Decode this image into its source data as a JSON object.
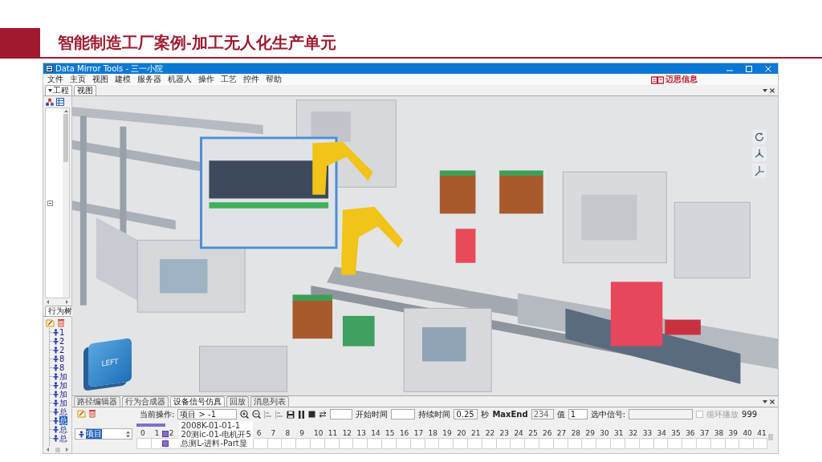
{
  "slide": {
    "title": "智能制造工厂案例-加工无人化生产单元"
  },
  "window": {
    "title": "Data Mirror Tools - 三一小院",
    "menu": [
      "文件",
      "主页",
      "视图",
      "建模",
      "服务器",
      "机器人",
      "操作",
      "工艺",
      "控件",
      "帮助"
    ],
    "logo": "迈思信息"
  },
  "project_panel": {
    "tab": "工程"
  },
  "behavior_panel": {
    "tab": "行为树",
    "items": [
      {
        "label": "1",
        "selected": false
      },
      {
        "label": "2",
        "selected": false
      },
      {
        "label": "2",
        "selected": false
      },
      {
        "label": "8",
        "selected": false
      },
      {
        "label": "8",
        "selected": false
      },
      {
        "label": "加",
        "selected": false
      },
      {
        "label": "加",
        "selected": false
      },
      {
        "label": "加",
        "selected": false
      },
      {
        "label": "加",
        "selected": false
      },
      {
        "label": "总",
        "selected": false
      },
      {
        "label": "总",
        "selected": true
      },
      {
        "label": "总",
        "selected": false
      },
      {
        "label": "总",
        "selected": false
      }
    ]
  },
  "viewport": {
    "tab": "视图",
    "view_cube": "LEFT"
  },
  "signal_panel": {
    "tabs": [
      {
        "label": "路径编辑器",
        "selected": false
      },
      {
        "label": "行为合成器",
        "selected": false
      },
      {
        "label": "设备信号仿真",
        "selected": true
      },
      {
        "label": "回放",
        "selected": false
      },
      {
        "label": "消息列表",
        "selected": false
      }
    ],
    "tree_item": {
      "label": "项目",
      "selected": true
    },
    "toolbar": {
      "operation": {
        "label": "当前操作:",
        "value": "项目 > -1"
      },
      "buttons": [
        {
          "kind": "zoom-in",
          "disabled": false
        },
        {
          "kind": "zoom-out",
          "disabled": false
        },
        {
          "kind": "align",
          "disabled": true
        },
        {
          "kind": "align",
          "disabled": true
        },
        {
          "kind": "save",
          "disabled": false
        },
        {
          "kind": "pause",
          "disabled": false
        },
        {
          "kind": "stop",
          "disabled": false
        },
        {
          "kind": "swap",
          "disabled": false
        }
      ],
      "start_time": {
        "label": "开始时间"
      },
      "duration": {
        "label": "持续时间",
        "value": "0.25",
        "unit": "秒"
      },
      "max_end": {
        "label": "MaxEnd",
        "value": "234",
        "disabled": true
      },
      "value": {
        "label": "值",
        "value": "1"
      },
      "selected_signal": {
        "label": "选中信号:",
        "disabled": true
      },
      "loop": {
        "label": "循环播放",
        "checked": false,
        "disabled": true
      },
      "count": "999"
    },
    "timeline": {
      "columns_before": [
        "0",
        "1",
        "2"
      ],
      "columns_after": [
        "6",
        "7",
        "8",
        "9",
        "10",
        "11",
        "12",
        "13",
        "14",
        "15",
        "16",
        "17",
        "18",
        "19",
        "20",
        "21",
        "22",
        "23",
        "24",
        "25",
        "26",
        "27",
        "28",
        "29",
        "30",
        "31",
        "32",
        "33",
        "34",
        "35",
        "36",
        "37",
        "38",
        "39",
        "40",
        "41"
      ],
      "popup_items": [
        "2008K-01-01-1",
        "20测ic-01-电机开5",
        "总测L-进料-Part显"
      ]
    }
  }
}
